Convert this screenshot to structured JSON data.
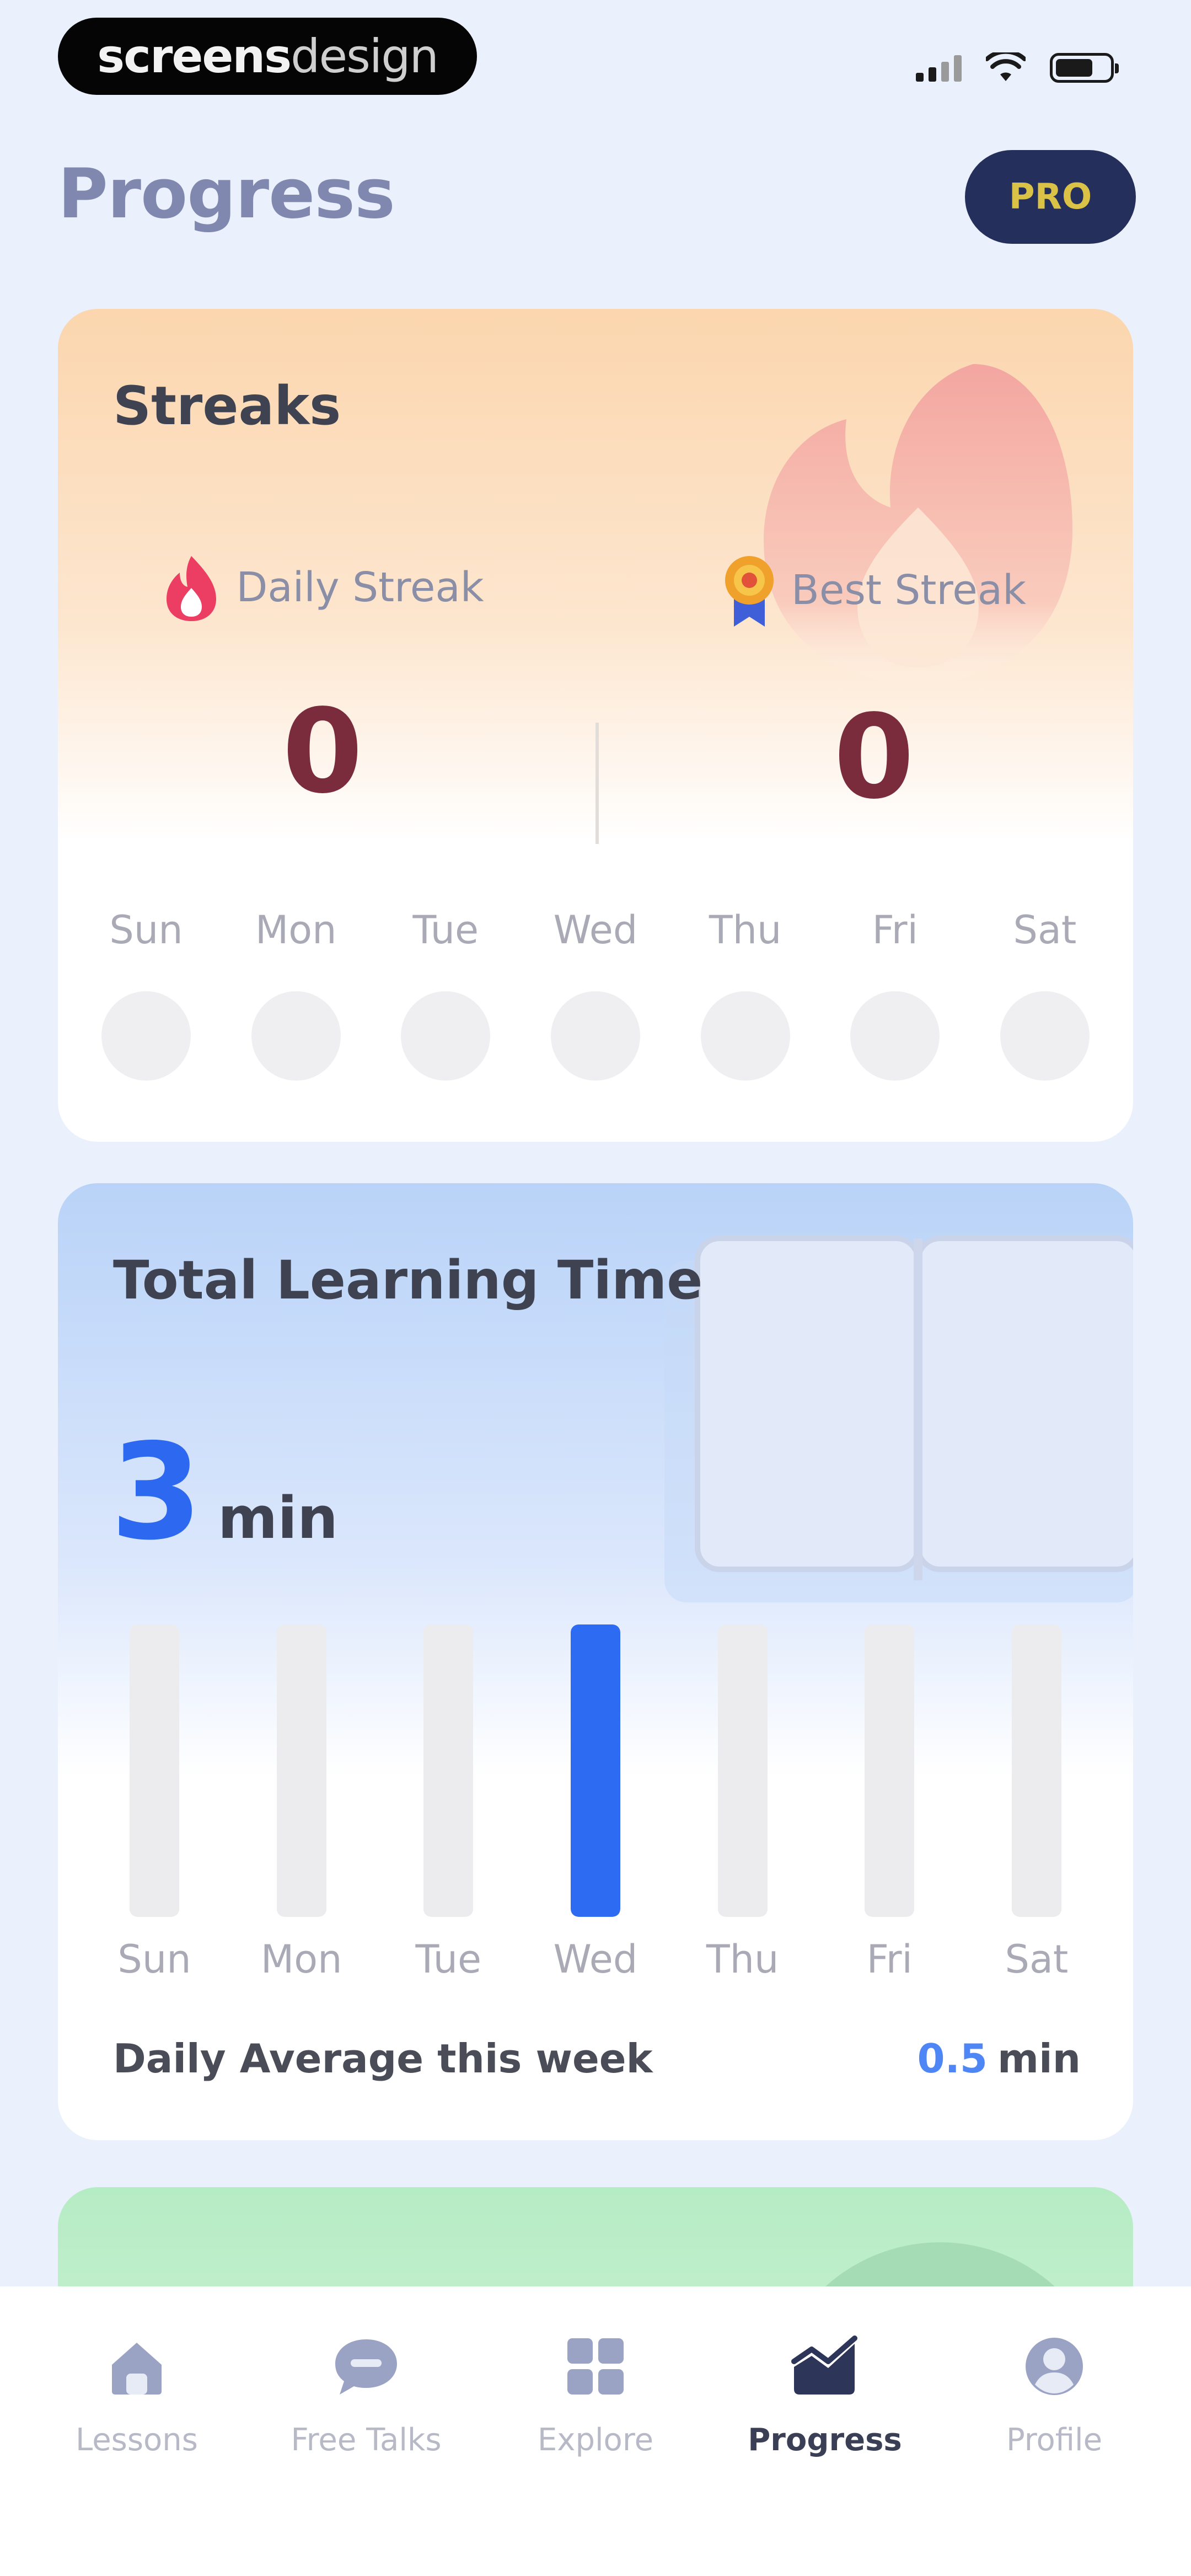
{
  "status_bar": {
    "brand_bold": "screens",
    "brand_light": "design",
    "icons": [
      "cellular-signal-icon",
      "wifi-icon",
      "battery-icon"
    ]
  },
  "header": {
    "title": "Progress",
    "badge": "PRO"
  },
  "streaks": {
    "title": "Streaks",
    "daily": {
      "label": "Daily Streak",
      "value": "0",
      "icon": "flame-icon"
    },
    "best": {
      "label": "Best Streak",
      "value": "0",
      "icon": "medal-icon"
    },
    "days": [
      "Sun",
      "Mon",
      "Tue",
      "Wed",
      "Thu",
      "Fri",
      "Sat"
    ]
  },
  "learning": {
    "title": "Total Learning Time",
    "total_value": "3",
    "total_unit": "min",
    "days": [
      "Sun",
      "Mon",
      "Tue",
      "Wed",
      "Thu",
      "Fri",
      "Sat"
    ],
    "daily_fill": [
      0,
      0,
      0,
      1,
      0,
      0,
      0
    ],
    "average_label": "Daily Average this week",
    "average_value": "0.5",
    "average_unit": "min"
  },
  "nav": {
    "active": "Progress",
    "items": [
      {
        "label": "Lessons",
        "icon": "house-icon"
      },
      {
        "label": "Free Talks",
        "icon": "chat-bubble-icon"
      },
      {
        "label": "Explore",
        "icon": "grid-icon"
      },
      {
        "label": "Progress",
        "icon": "chart-icon"
      },
      {
        "label": "Profile",
        "icon": "person-icon"
      }
    ]
  },
  "colors": {
    "background": "#eaf0fc",
    "accent_blue": "#2d6cf2",
    "streak_value": "#7a2c3d",
    "pro_badge": "#252f5b",
    "pro_text": "#d9c246"
  }
}
